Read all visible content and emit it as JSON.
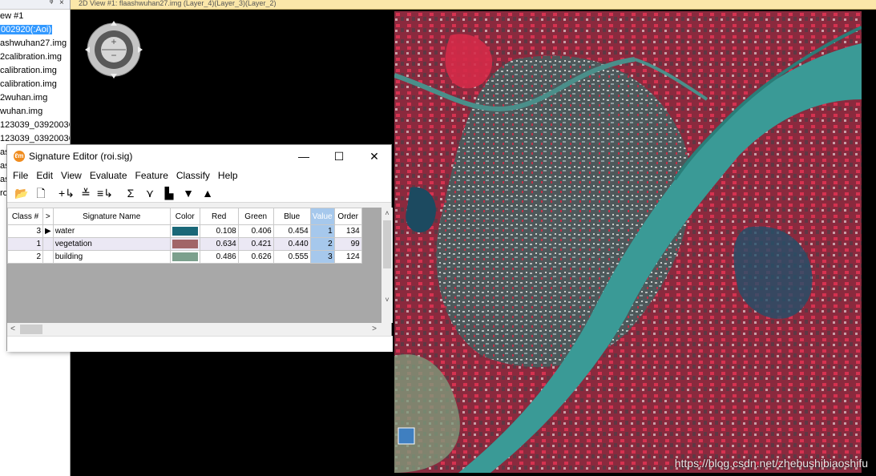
{
  "view_title": "2D View #1: flaashwuhan27.img (Layer_4)(Layer_3)(Layer_2)",
  "left_panel": {
    "header_pin": "ᵠ",
    "header_close": "×",
    "items": [
      {
        "label": "ew #1",
        "selected": false
      },
      {
        "label": "002920(:Aoi)",
        "selected": true
      },
      {
        "label": "ashwuhan27.img",
        "selected": false
      },
      {
        "label": "2calibration.img",
        "selected": false
      },
      {
        "label": "calibration.img",
        "selected": false
      },
      {
        "label": "calibration.img",
        "selected": false
      },
      {
        "label": "2wuhan.img",
        "selected": false
      },
      {
        "label": "wuhan.img",
        "selected": false
      },
      {
        "label": "123039_0392003C",
        "selected": false
      },
      {
        "label": "123039_0392003C",
        "selected": false
      },
      {
        "label": "as",
        "selected": false
      },
      {
        "label": "as",
        "selected": false
      },
      {
        "label": "as",
        "selected": false
      },
      {
        "label": "ro",
        "selected": false
      }
    ]
  },
  "editor": {
    "title": "Signature Editor (roi.sig)",
    "app_icon": "ℓm",
    "minimize": "—",
    "maximize": "☐",
    "close": "✕",
    "menu": [
      "File",
      "Edit",
      "View",
      "Evaluate",
      "Feature",
      "Classify",
      "Help"
    ],
    "toolbar_icons": [
      {
        "name": "open-folder-icon",
        "glyph": "📂"
      },
      {
        "name": "new-file-icon",
        "glyph": "🗋"
      },
      {
        "name": "add-signature-icon",
        "glyph": "+↳"
      },
      {
        "name": "merge-icon",
        "glyph": "≚"
      },
      {
        "name": "replace-icon",
        "glyph": "≡↳"
      },
      {
        "name": "statistics-icon",
        "glyph": "Σ"
      },
      {
        "name": "mean-plot-icon",
        "glyph": "⋎"
      },
      {
        "name": "histogram-icon",
        "glyph": "▙"
      },
      {
        "name": "sort-down-icon",
        "glyph": "▼"
      },
      {
        "name": "sort-up-icon",
        "glyph": "▲"
      }
    ],
    "columns": [
      "Class #",
      ">",
      "Signature Name",
      "Color",
      "Red",
      "Green",
      "Blue",
      "Value",
      "Order"
    ],
    "rows": [
      {
        "class_no": "3",
        "marker": "▶",
        "name": "water",
        "color": "#1a6878",
        "red": "0.108",
        "green": "0.406",
        "blue": "0.454",
        "value": "1",
        "order": "134",
        "selected": false
      },
      {
        "class_no": "1",
        "marker": "",
        "name": "vegetation",
        "color": "#a16568",
        "red": "0.634",
        "green": "0.421",
        "blue": "0.440",
        "value": "2",
        "order": "99",
        "selected": true
      },
      {
        "class_no": "2",
        "marker": "",
        "name": "building",
        "color": "#7ca08d",
        "red": "0.486",
        "green": "0.626",
        "blue": "0.555",
        "value": "3",
        "order": "124",
        "selected": false
      }
    ],
    "scroll_up": "˄",
    "scroll_down": "˅",
    "scroll_left": "<",
    "scroll_right": ">"
  },
  "watermark": "https://blog.csdn.net/zhebushibiaoshifu"
}
